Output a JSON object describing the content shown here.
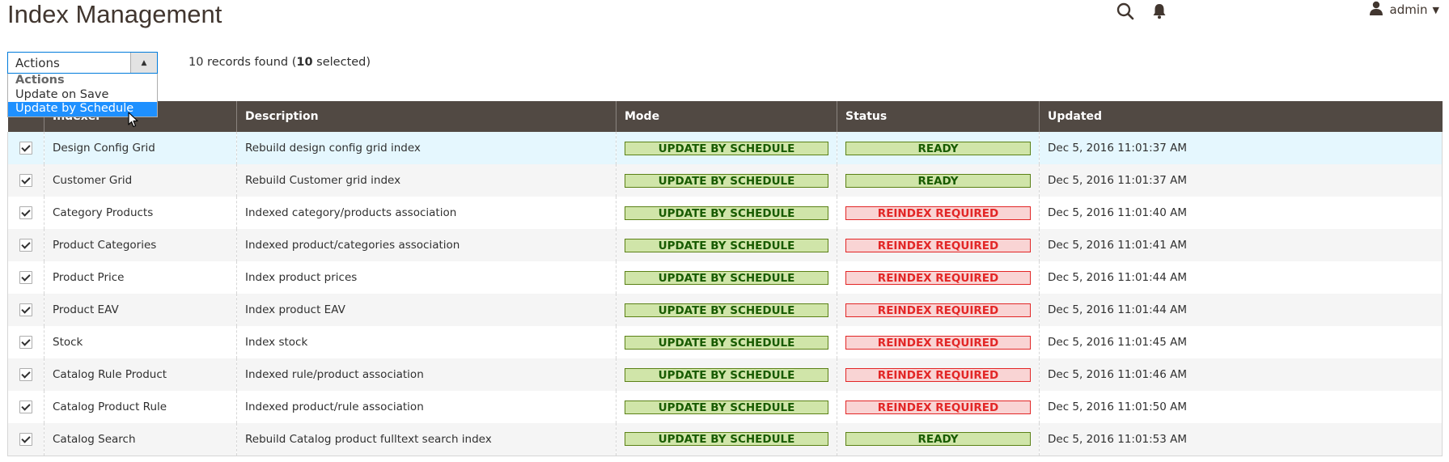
{
  "header": {
    "title": "Index Management",
    "user_name": "admin"
  },
  "actions": {
    "selected_label": "Actions",
    "menu_group": "Actions",
    "options": [
      "Update on Save",
      "Update by Schedule"
    ]
  },
  "records": {
    "prefix": "10 records found (",
    "selected_count": "10",
    "suffix": " selected)"
  },
  "grid": {
    "columns": [
      "Indexer",
      "Description",
      "Mode",
      "Status",
      "Updated"
    ],
    "rows": [
      {
        "checked": true,
        "indexer": "Design Config Grid",
        "description": "Rebuild design config grid index",
        "mode": "UPDATE BY SCHEDULE",
        "status": "READY",
        "updated": "Dec 5, 2016 11:01:37 AM"
      },
      {
        "checked": true,
        "indexer": "Customer Grid",
        "description": "Rebuild Customer grid index",
        "mode": "UPDATE BY SCHEDULE",
        "status": "READY",
        "updated": "Dec 5, 2016 11:01:37 AM"
      },
      {
        "checked": true,
        "indexer": "Category Products",
        "description": "Indexed category/products association",
        "mode": "UPDATE BY SCHEDULE",
        "status": "REINDEX REQUIRED",
        "updated": "Dec 5, 2016 11:01:40 AM"
      },
      {
        "checked": true,
        "indexer": "Product Categories",
        "description": "Indexed product/categories association",
        "mode": "UPDATE BY SCHEDULE",
        "status": "REINDEX REQUIRED",
        "updated": "Dec 5, 2016 11:01:41 AM"
      },
      {
        "checked": true,
        "indexer": "Product Price",
        "description": "Index product prices",
        "mode": "UPDATE BY SCHEDULE",
        "status": "REINDEX REQUIRED",
        "updated": "Dec 5, 2016 11:01:44 AM"
      },
      {
        "checked": true,
        "indexer": "Product EAV",
        "description": "Index product EAV",
        "mode": "UPDATE BY SCHEDULE",
        "status": "REINDEX REQUIRED",
        "updated": "Dec 5, 2016 11:01:44 AM"
      },
      {
        "checked": true,
        "indexer": "Stock",
        "description": "Index stock",
        "mode": "UPDATE BY SCHEDULE",
        "status": "REINDEX REQUIRED",
        "updated": "Dec 5, 2016 11:01:45 AM"
      },
      {
        "checked": true,
        "indexer": "Catalog Rule Product",
        "description": "Indexed rule/product association",
        "mode": "UPDATE BY SCHEDULE",
        "status": "REINDEX REQUIRED",
        "updated": "Dec 5, 2016 11:01:46 AM"
      },
      {
        "checked": true,
        "indexer": "Catalog Product Rule",
        "description": "Indexed product/rule association",
        "mode": "UPDATE BY SCHEDULE",
        "status": "REINDEX REQUIRED",
        "updated": "Dec 5, 2016 11:01:50 AM"
      },
      {
        "checked": true,
        "indexer": "Catalog Search",
        "description": "Rebuild Catalog product fulltext search index",
        "mode": "UPDATE BY SCHEDULE",
        "status": "READY",
        "updated": "Dec 5, 2016 11:01:53 AM"
      }
    ]
  },
  "colors": {
    "header_bg": "#514943",
    "ready_bg": "#d0e5a9",
    "ready_text": "#185b00",
    "reindex_bg": "#f9d4d4",
    "reindex_text": "#e22626",
    "select_focus": "#007bdb",
    "menu_selected": "#1e90ff"
  },
  "icons": [
    "search-icon",
    "bell-icon",
    "user-icon",
    "chevron-down-icon",
    "arrow-up-icon",
    "checkmark-icon",
    "mouse-cursor-icon"
  ]
}
